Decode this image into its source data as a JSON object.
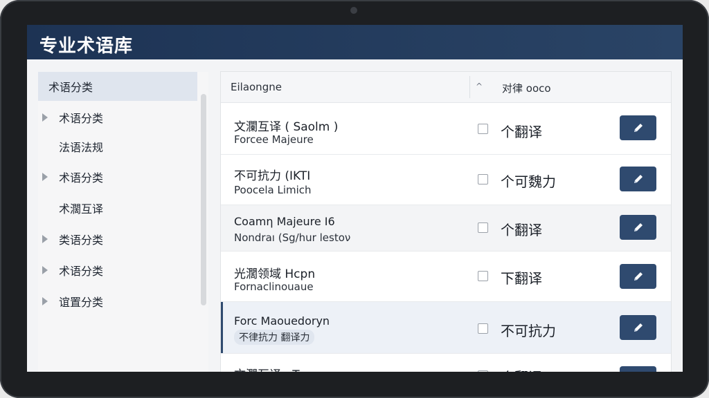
{
  "header": {
    "title": "专业术语库"
  },
  "sidebar": {
    "heading": "术语分类",
    "items": [
      {
        "label": "术语分类",
        "has_arrow": true
      },
      {
        "label": "法语法规",
        "has_arrow": false
      },
      {
        "label": "术语分类",
        "has_arrow": true
      },
      {
        "label": "术濶互译",
        "has_arrow": false
      },
      {
        "label": "类语分类",
        "has_arrow": true
      },
      {
        "label": "术语分类",
        "has_arrow": true
      },
      {
        "label": "谊置分类",
        "has_arrow": true
      }
    ]
  },
  "table": {
    "col1_header": "Eilaongne",
    "sort_glyph": "^",
    "col2_header": "对律 ooco",
    "rows": [
      {
        "line1": "文瀾互译 ( Saolm )",
        "line2": "Forcee Majeure",
        "translation": "个翻译",
        "selected": false
      },
      {
        "line1": "不可抗力 (IKTI",
        "line2": "Poocela Limich",
        "translation": "个可魏力",
        "selected": false
      },
      {
        "line1": "Coamη Majeure I6",
        "line2": "Nondraı (Sg/hur lestoν",
        "translation": "个翻译",
        "selected": false
      },
      {
        "line1": "光濶领域 Hcpn",
        "line2": "Fornaclinouaue",
        "translation": "下翻译",
        "selected": false
      },
      {
        "line1": "Forc Maouedoryn",
        "line2": "不律抗力 翻译力",
        "translation": "不可抗力",
        "selected": true
      },
      {
        "line1": "文濶互译 · T",
        "line2": "",
        "translation": "个翻译",
        "selected": false
      }
    ]
  },
  "colors": {
    "header_bg": "#1d3354",
    "accent": "#2f4a6f",
    "selected_row": "#edf1f7"
  }
}
